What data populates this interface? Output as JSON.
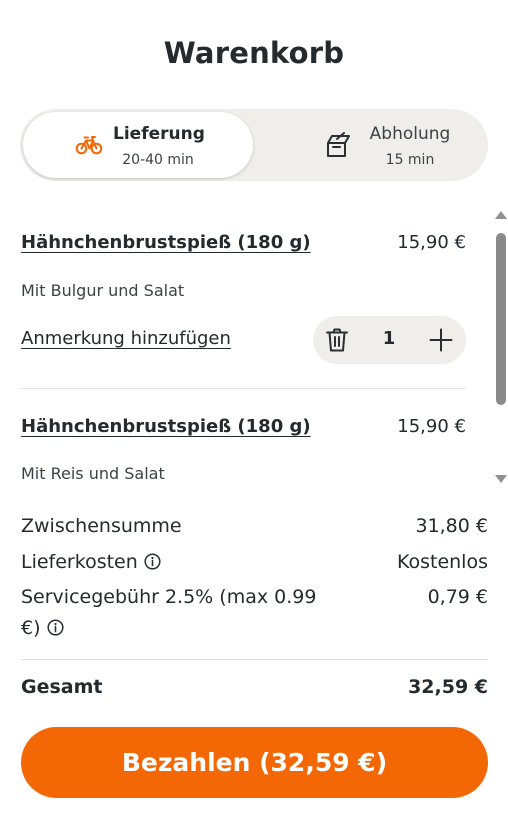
{
  "header": {
    "title": "Warenkorb"
  },
  "delivery_toggle": {
    "accent_color": "#f36805",
    "options": [
      {
        "label": "Lieferung",
        "sub": "20-40 min",
        "icon": "bicycle-icon",
        "selected": true
      },
      {
        "label": "Abholung",
        "sub": "15 min",
        "icon": "takeaway-bag-icon",
        "selected": false
      }
    ]
  },
  "cart": {
    "items": [
      {
        "name": "Hähnchenbrustspieß (180 g)",
        "price": "15,90 €",
        "description": "Mit Bulgur und Salat",
        "note_link": "Anmerkung hinzufügen",
        "quantity": "1"
      },
      {
        "name": "Hähnchenbrustspieß (180 g)",
        "price": "15,90 €",
        "description": "Mit Reis und Salat"
      }
    ]
  },
  "summary": {
    "subtotal_label": "Zwischensumme",
    "subtotal_value": "31,80 €",
    "delivery_label": "Lieferkosten",
    "delivery_value": "Kostenlos",
    "service_label_line1": "Servicegebühr 2.5% (max 0.99",
    "service_label_line2": "€)",
    "service_value": "0,79 €",
    "total_label": "Gesamt",
    "total_value": "32,59 €"
  },
  "checkout": {
    "button_label": "Bezahlen (32,59 €)",
    "button_color": "#f36805"
  }
}
